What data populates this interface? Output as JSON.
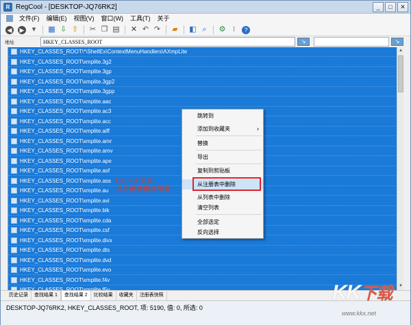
{
  "window": {
    "title": "RegCool - [DESKTOP-JQ76RK2]",
    "app_icon_letter": "R",
    "minimize": "_",
    "maximize": "□",
    "close": "✕"
  },
  "menubar": {
    "items": [
      "文件(F)",
      "编辑(E)",
      "视图(V)",
      "窗口(W)",
      "工具(T)",
      "关于"
    ]
  },
  "toolbar": {
    "icons": [
      {
        "name": "back-icon",
        "glyph": "◀"
      },
      {
        "name": "forward-icon",
        "glyph": "▶"
      },
      {
        "name": "history-dropdown-icon",
        "glyph": "▾"
      },
      {
        "name": "registry-icon",
        "glyph": "▦"
      },
      {
        "name": "import-icon",
        "glyph": "⇩"
      },
      {
        "name": "export-icon",
        "glyph": "⇧"
      },
      {
        "name": "cut-icon",
        "glyph": "✂"
      },
      {
        "name": "copy-icon",
        "glyph": "❐"
      },
      {
        "name": "paste-icon",
        "glyph": "▤"
      },
      {
        "name": "delete-icon",
        "glyph": "✕"
      },
      {
        "name": "undo-icon",
        "glyph": "↶"
      },
      {
        "name": "redo-icon",
        "glyph": "↷"
      },
      {
        "name": "folder-icon",
        "glyph": "▰"
      },
      {
        "name": "compare-icon",
        "glyph": "◧"
      },
      {
        "name": "search-registry-icon",
        "glyph": "⌕"
      },
      {
        "name": "options-icon",
        "glyph": "⚙"
      },
      {
        "name": "help-icon",
        "glyph": "?"
      }
    ]
  },
  "addressbar": {
    "label": "地址",
    "value": "HKEY_CLASSES_ROOT",
    "go_glyph": "↘",
    "search_value": "",
    "search_glyph": "↘"
  },
  "list": {
    "rows": [
      "HKEY_CLASSES_ROOT\\*\\ShellEx\\ContextMenuHandlers\\AXmpLite",
      "HKEY_CLASSES_ROOT\\xmplite.3g2",
      "HKEY_CLASSES_ROOT\\xmplite.3gp",
      "HKEY_CLASSES_ROOT\\xmplite.3gp2",
      "HKEY_CLASSES_ROOT\\xmplite.3gpp",
      "HKEY_CLASSES_ROOT\\xmplite.aac",
      "HKEY_CLASSES_ROOT\\xmplite.ac3",
      "HKEY_CLASSES_ROOT\\xmplite.acc",
      "HKEY_CLASSES_ROOT\\xmplite.aiff",
      "HKEY_CLASSES_ROOT\\xmplite.amr",
      "HKEY_CLASSES_ROOT\\xmplite.amv",
      "HKEY_CLASSES_ROOT\\xmplite.ape",
      "HKEY_CLASSES_ROOT\\xmplite.asf",
      "HKEY_CLASSES_ROOT\\xmplite.ass",
      "HKEY_CLASSES_ROOT\\xmplite.au",
      "HKEY_CLASSES_ROOT\\xmplite.avi",
      "HKEY_CLASSES_ROOT\\xmplite.bik",
      "HKEY_CLASSES_ROOT\\xmplite.cda",
      "HKEY_CLASSES_ROOT\\xmplite.csf",
      "HKEY_CLASSES_ROOT\\xmplite.divx",
      "HKEY_CLASSES_ROOT\\xmplite.dts",
      "HKEY_CLASSES_ROOT\\xmplite.dvd",
      "HKEY_CLASSES_ROOT\\xmplite.evo",
      "HKEY_CLASSES_ROOT\\xmplite.f4v",
      "HKEY_CLASSES_ROOT\\xmplite.f5v"
    ]
  },
  "annotation": {
    "line1": "Ctrl + A 全选",
    "line2": "从注册表删除所有"
  },
  "context_menu": {
    "items": [
      {
        "label": "跳转到",
        "highlighted": false,
        "submenu": false
      },
      {
        "label": "添加到收藏夹",
        "highlighted": false,
        "submenu": true
      },
      {
        "label": "替换",
        "highlighted": false,
        "submenu": false
      },
      {
        "label": "导出",
        "highlighted": false,
        "submenu": false
      },
      {
        "label": "复制到剪贴板",
        "highlighted": false,
        "submenu": false
      },
      {
        "label": "从注册表中删除",
        "highlighted": true,
        "submenu": false
      },
      {
        "label": "从列表中删除",
        "highlighted": false,
        "submenu": false
      },
      {
        "label": "清空列表",
        "highlighted": false,
        "submenu": false
      },
      {
        "label": "全部选定",
        "highlighted": false,
        "submenu": false
      },
      {
        "label": "反向选择",
        "highlighted": false,
        "submenu": false
      }
    ],
    "submenu_arrow": "›"
  },
  "tabs": {
    "items": [
      "历史记录",
      "查找结果 1",
      "查找结果 2",
      "比较结果",
      "收藏夹",
      "注册表快照"
    ],
    "active_index": 2
  },
  "statusbar": {
    "text": "DESKTOP-JQ76RK2, HKEY_CLASSES_ROOT, 项: 5190, 值: 0, 所选: 0"
  },
  "watermark": {
    "logo": "KK",
    "logo_cn": "下载",
    "url": "www.kkx.net"
  },
  "colors": {
    "selection": "#1a7ad8",
    "annotation": "#d73a2a",
    "highlight_border": "#e0202a"
  }
}
